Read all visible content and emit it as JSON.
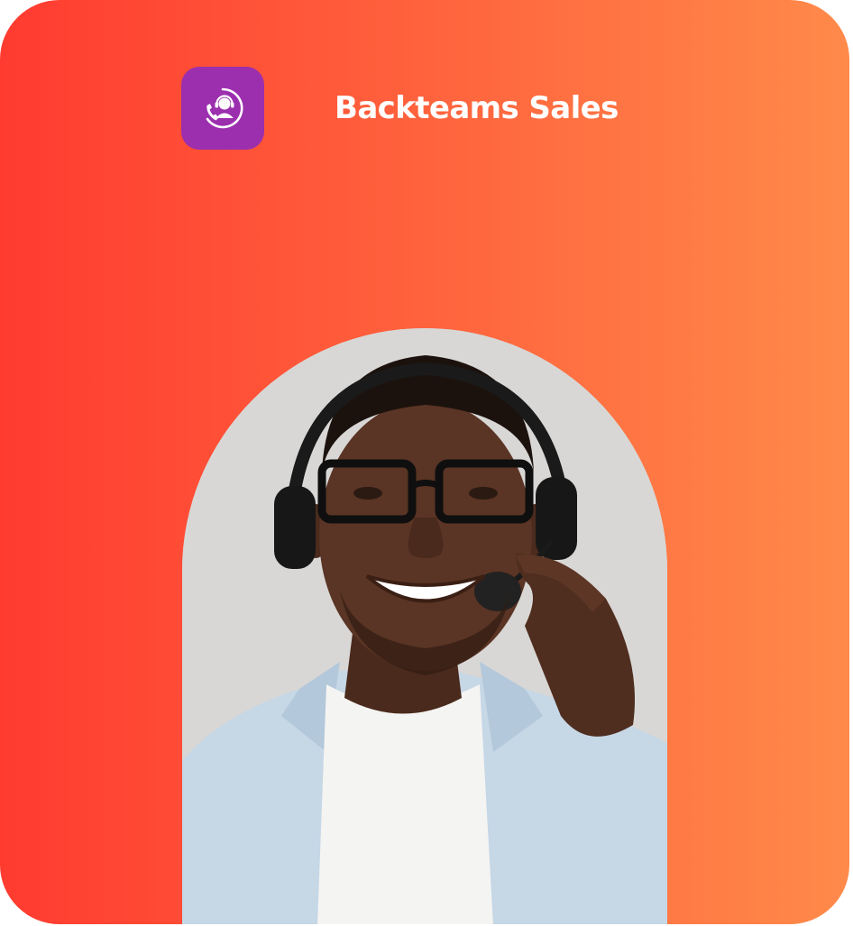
{
  "card": {
    "gradient_start": "#ff3b30",
    "gradient_end": "#ff8a4a"
  },
  "app": {
    "title": "Backteams Sales",
    "icon": "headset-agent-icon",
    "icon_bg": "#9b2fae",
    "title_color": "#ffffff"
  },
  "photo": {
    "subject": "smiling-support-agent-photo",
    "backdrop_color": "#d8d7d5"
  }
}
